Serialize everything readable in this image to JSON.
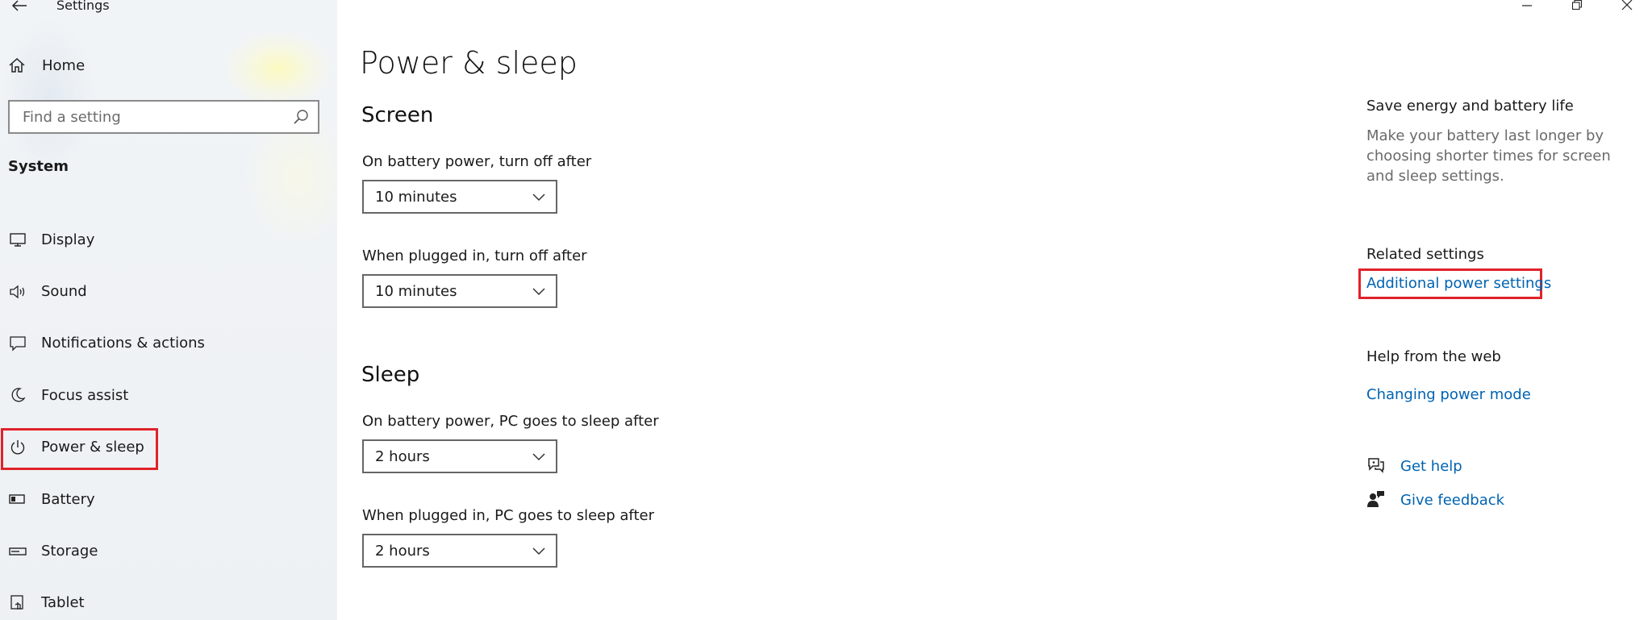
{
  "window": {
    "title": "Settings"
  },
  "sidebar": {
    "home_label": "Home",
    "search_placeholder": "Find a setting",
    "section_label": "System",
    "items": [
      {
        "label": "Display",
        "icon": "monitor-icon"
      },
      {
        "label": "Sound",
        "icon": "speaker-icon"
      },
      {
        "label": "Notifications & actions",
        "icon": "notification-icon"
      },
      {
        "label": "Focus assist",
        "icon": "moon-icon"
      },
      {
        "label": "Power & sleep",
        "icon": "power-icon",
        "highlighted": true
      },
      {
        "label": "Battery",
        "icon": "battery-icon"
      },
      {
        "label": "Storage",
        "icon": "storage-icon"
      },
      {
        "label": "Tablet",
        "icon": "tablet-icon"
      }
    ]
  },
  "main": {
    "title": "Power & sleep",
    "screen": {
      "heading": "Screen",
      "battery_label": "On battery power, turn off after",
      "battery_value": "10 minutes",
      "plugged_label": "When plugged in, turn off after",
      "plugged_value": "10 minutes"
    },
    "sleep": {
      "heading": "Sleep",
      "battery_label": "On battery power, PC goes to sleep after",
      "battery_value": "2 hours",
      "plugged_label": "When plugged in, PC goes to sleep after",
      "plugged_value": "2 hours"
    }
  },
  "right": {
    "save_heading": "Save energy and battery life",
    "save_desc": "Make your battery last longer by choosing shorter times for screen and sleep settings.",
    "related_heading": "Related settings",
    "additional_power_link": "Additional power settings",
    "help_heading": "Help from the web",
    "changing_power_link": "Changing power mode",
    "get_help_link": "Get help",
    "give_feedback_link": "Give feedback"
  },
  "colors": {
    "accent_link": "#0063b1",
    "highlight_border": "#e0222a"
  }
}
